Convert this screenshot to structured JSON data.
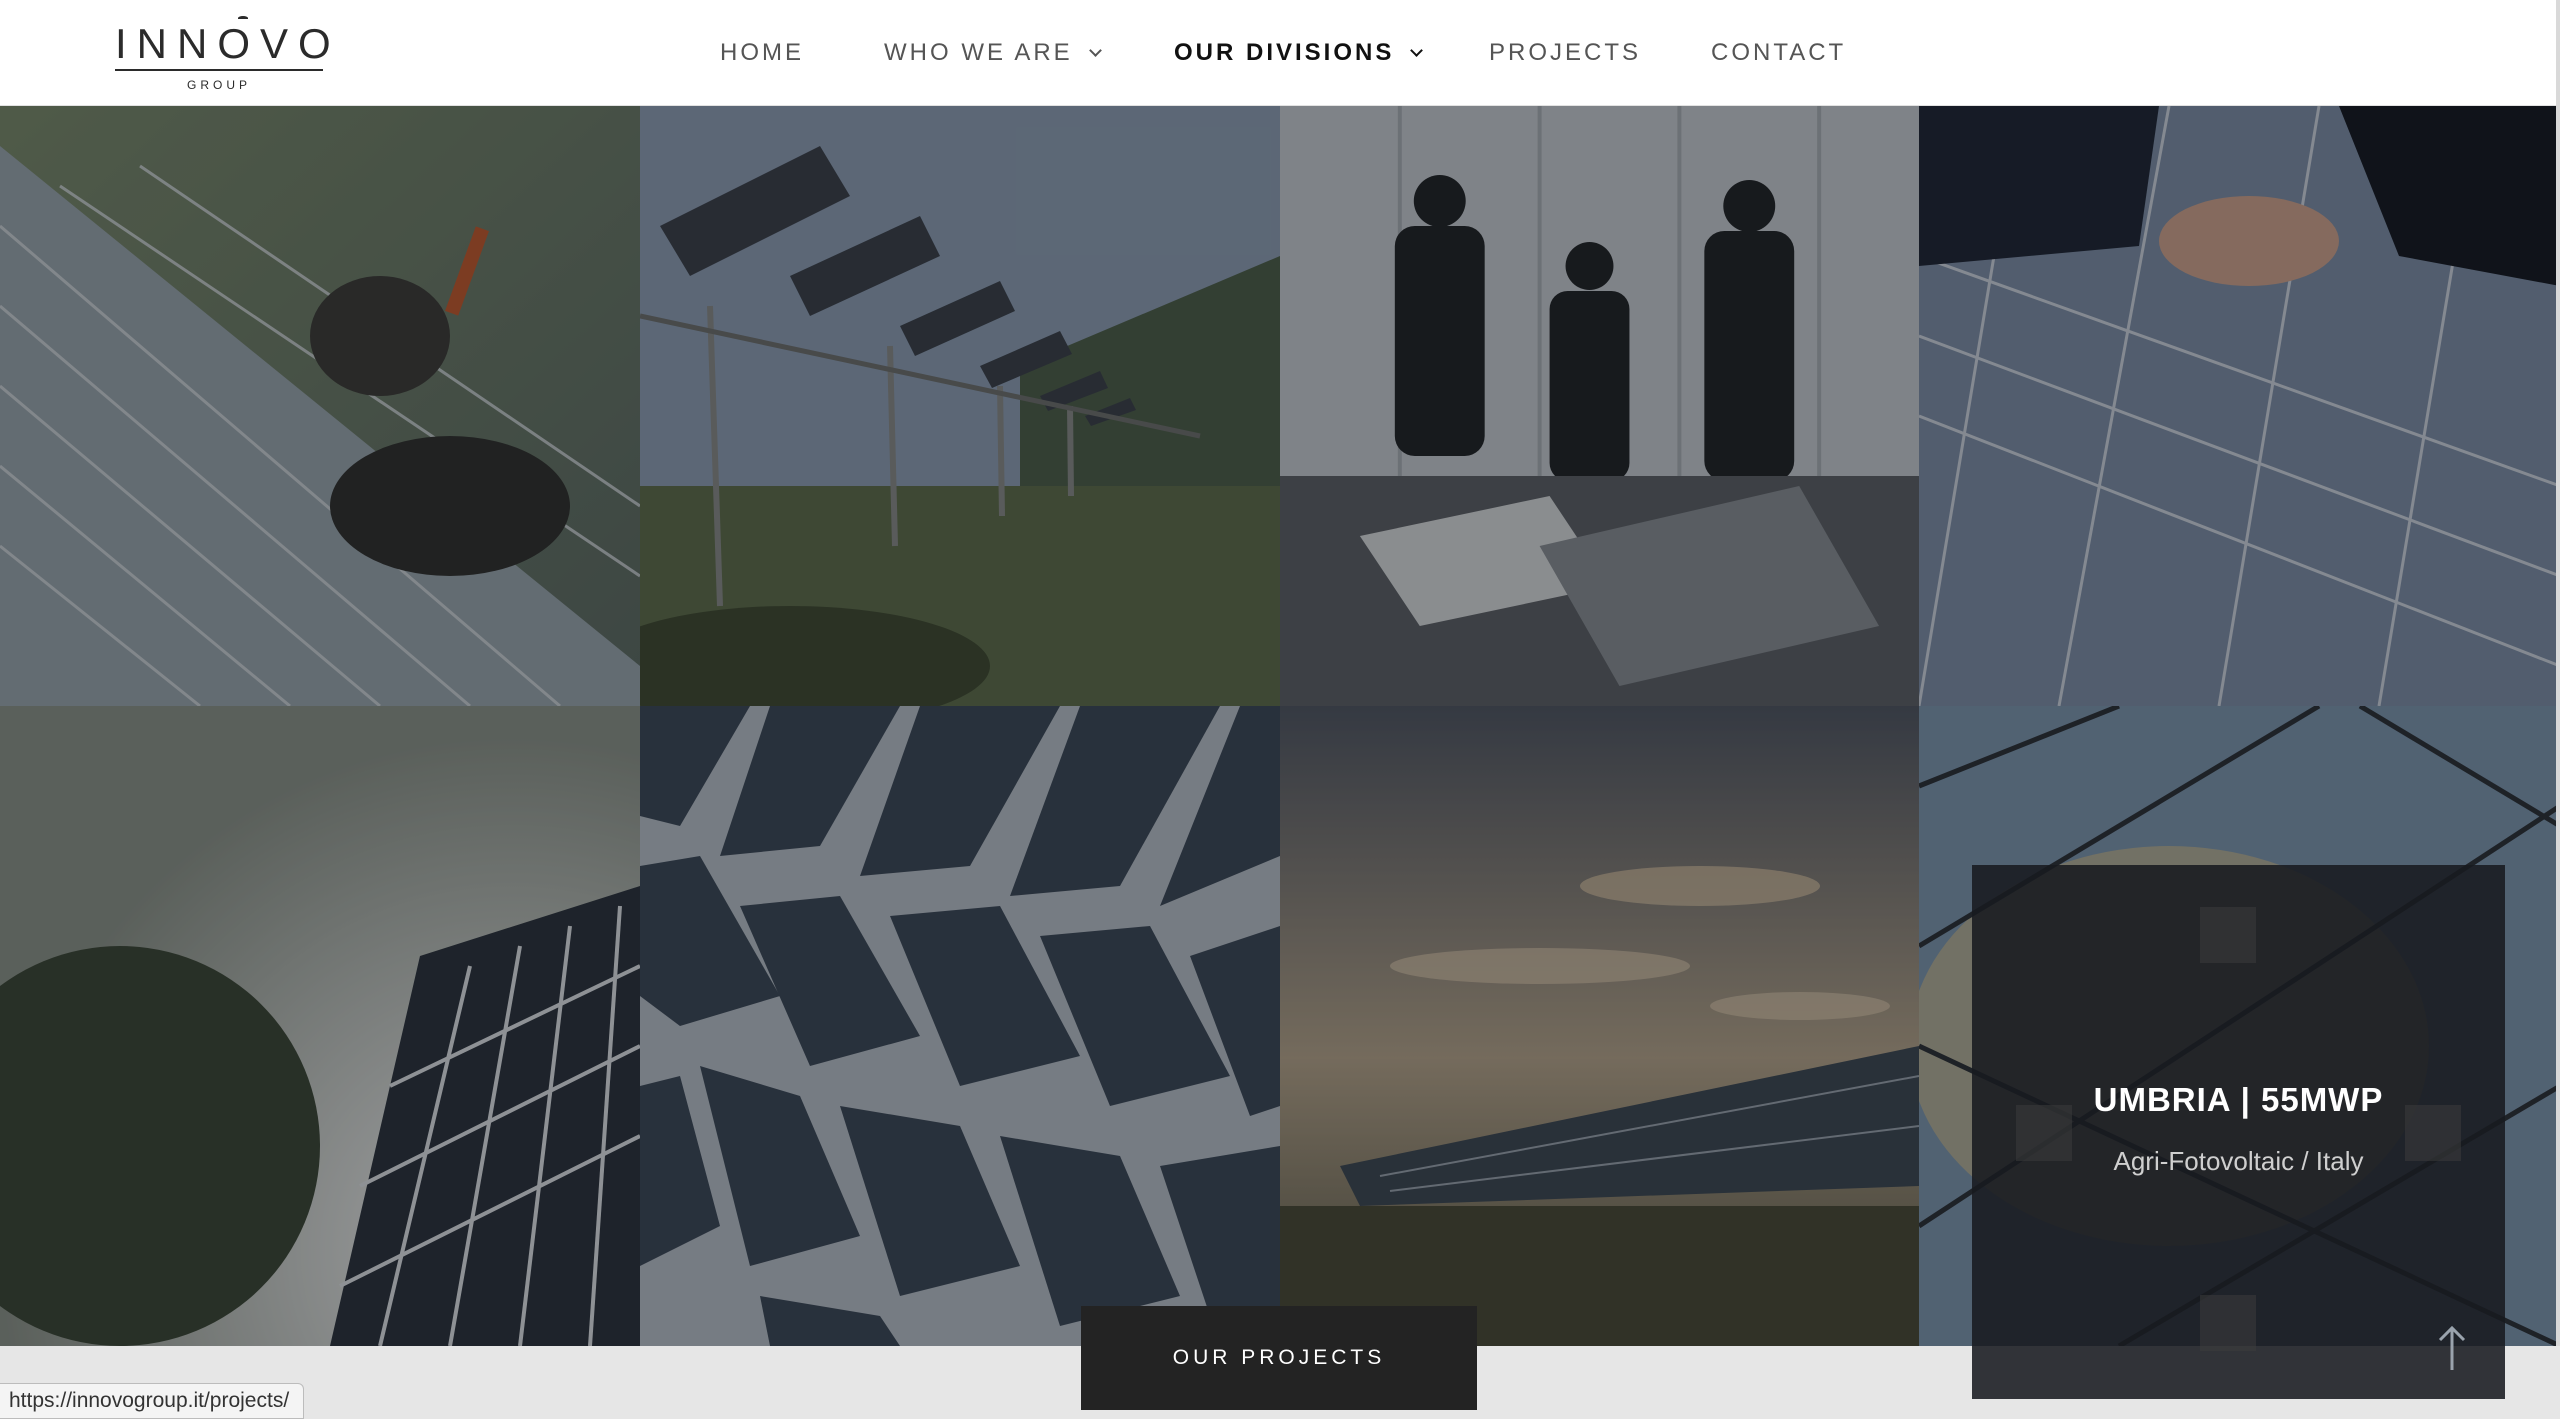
{
  "logo": {
    "word": "INNOVO",
    "sub": "GROUP"
  },
  "nav": {
    "items": [
      {
        "label": "HOME"
      },
      {
        "label": "WHO WE ARE"
      },
      {
        "label": "OUR DIVISIONS"
      },
      {
        "label": "PROJECTS"
      },
      {
        "label": "CONTACT"
      }
    ]
  },
  "project_card": {
    "title": "UMBRIA | 55MWP",
    "subtitle": "Agri-Fotovoltaic / Italy"
  },
  "cta": {
    "label": "OUR PROJECTS"
  },
  "status_bar": {
    "url": "https://innovogroup.it/projects/"
  },
  "icons": [
    "chevron-down-icon",
    "arrow-up-icon"
  ],
  "colors": {
    "header_bg": "#ffffff",
    "button_bg": "#232323",
    "card_bg": "#181a20"
  }
}
